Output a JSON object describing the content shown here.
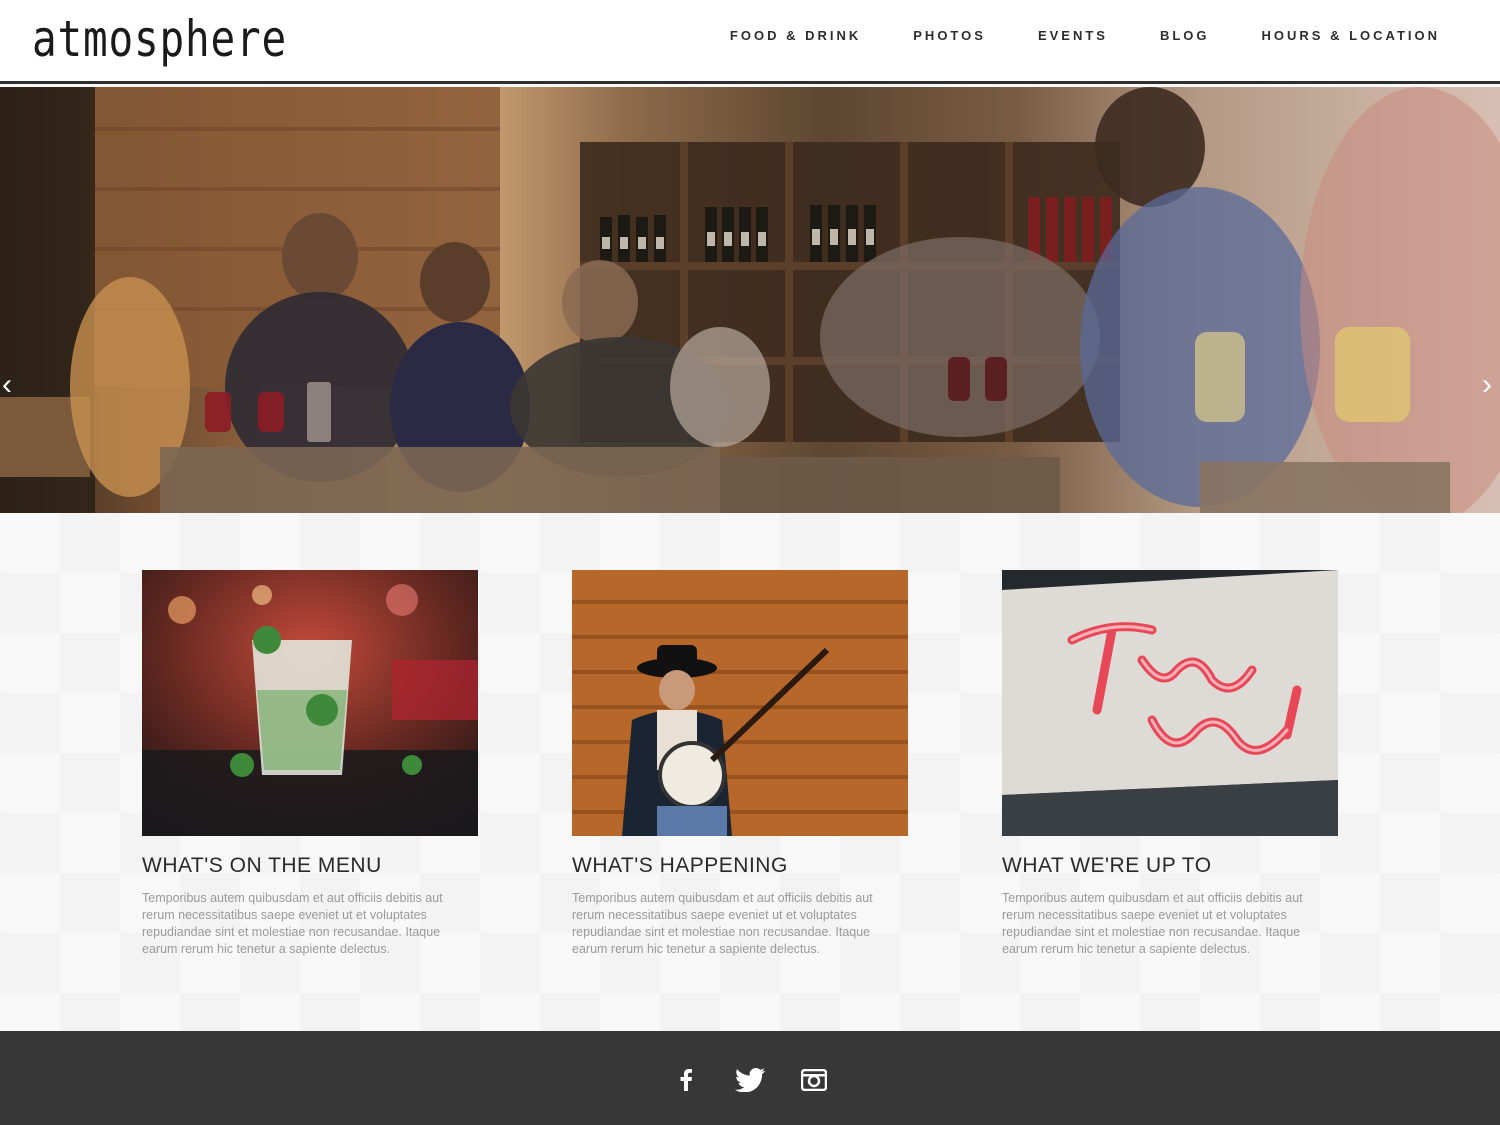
{
  "brand": {
    "logo": "atmosphere"
  },
  "nav": {
    "items": [
      {
        "label": "FOOD & DRINK"
      },
      {
        "label": "PHOTOS"
      },
      {
        "label": "EVENTS"
      },
      {
        "label": "BLOG"
      },
      {
        "label": "HOURS & LOCATION"
      }
    ]
  },
  "hero": {
    "prev_icon": "chevron-left-icon",
    "next_icon": "chevron-right-icon",
    "prev_glyph": "‹",
    "next_glyph": "›"
  },
  "cards": [
    {
      "title": "WHAT'S ON THE MENU",
      "text": "Temporibus autem quibusdam et aut officiis debitis aut rerum necessitatibus saepe eveniet ut et voluptates repudiandae sint et molestiae non recusandae. Itaque earum rerum hic tenetur a sapiente delectus."
    },
    {
      "title": "WHAT'S HAPPENING",
      "text": "Temporibus autem quibusdam et aut officiis debitis aut rerum necessitatibus saepe eveniet ut et voluptates repudiandae sint et molestiae non recusandae. Itaque earum rerum hic tenetur a sapiente delectus."
    },
    {
      "title": "WHAT WE'RE UP TO",
      "text": "Temporibus autem quibusdam et aut officiis debitis aut rerum necessitatibus saepe eveniet ut et voluptates repudiandae sint et molestiae non recusandae. Itaque earum rerum hic tenetur a sapiente delectus."
    }
  ],
  "footer": {
    "social": [
      "facebook-icon",
      "twitter-icon",
      "instagram-icon"
    ]
  },
  "colors": {
    "header_bg": "#ffffff",
    "header_border": "#2f2f2f",
    "footer_bg": "#373737",
    "card_title": "#2a2a2a",
    "card_text": "#9a9a9a"
  }
}
